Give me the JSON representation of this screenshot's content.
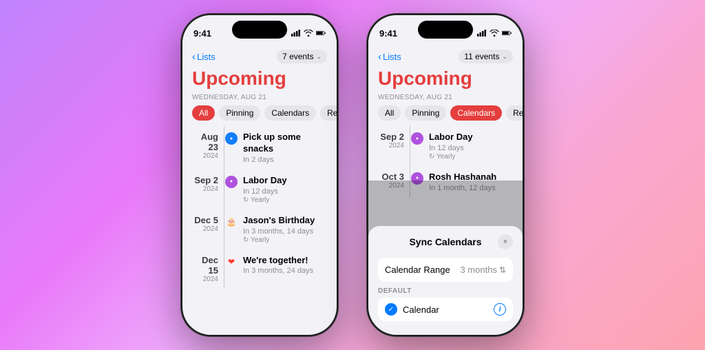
{
  "phone1": {
    "status": {
      "time": "9:41",
      "signal": "signal",
      "wifi": "wifi",
      "battery": "battery"
    },
    "nav": {
      "back_label": "Lists",
      "events_count": "7 events"
    },
    "title": "Upcoming",
    "date_label": "WEDNESDAY, AUG 21",
    "filters": [
      {
        "label": "All",
        "active": true
      },
      {
        "label": "Pinning",
        "active": false
      },
      {
        "label": "Calendars",
        "active": false
      },
      {
        "label": "Reminders",
        "active": false
      }
    ],
    "events": [
      {
        "date": "Aug 23",
        "year": "2024",
        "icon_type": "blue",
        "icon_char": "●",
        "title": "Pick up some snacks",
        "subtitle": "In 2 days",
        "recur": ""
      },
      {
        "date": "Sep 2",
        "year": "2024",
        "icon_type": "purple",
        "icon_char": "●",
        "title": "Labor Day",
        "subtitle": "In 12 days",
        "recur": "↻ Yearly"
      },
      {
        "date": "Dec 5",
        "year": "2024",
        "icon_type": "emoji",
        "icon_char": "🎂",
        "title": "Jason's Birthday",
        "subtitle": "In 3 months, 14 days",
        "recur": "↻ Yearly"
      },
      {
        "date": "Dec 15",
        "year": "2024",
        "icon_type": "red",
        "icon_char": "❤",
        "title": "We're together!",
        "subtitle": "In 3 months, 24 days",
        "recur": ""
      }
    ]
  },
  "phone2": {
    "status": {
      "time": "9:41"
    },
    "nav": {
      "back_label": "Lists",
      "events_count": "11 events"
    },
    "title": "Upcoming",
    "date_label": "WEDNESDAY, AUG 21",
    "filters": [
      {
        "label": "All",
        "active": false
      },
      {
        "label": "Pinning",
        "active": false
      },
      {
        "label": "Calendars",
        "active": true
      },
      {
        "label": "Reminders",
        "active": false
      }
    ],
    "events": [
      {
        "date": "Sep 2",
        "year": "2024",
        "icon_type": "purple",
        "title": "Labor Day",
        "subtitle": "In 12 days",
        "recur": "↻ Yearly"
      },
      {
        "date": "Oct 3",
        "year": "2024",
        "icon_type": "purple",
        "title": "Rosh Hashanah",
        "subtitle": "In 1 month, 12 days",
        "recur": ""
      }
    ],
    "modal": {
      "title": "Sync Calendars",
      "close_label": "×",
      "calendar_range_label": "Calendar Range",
      "calendar_range_value": "3 months",
      "default_section": "DEFAULT",
      "calendar_name": "Calendar"
    }
  }
}
